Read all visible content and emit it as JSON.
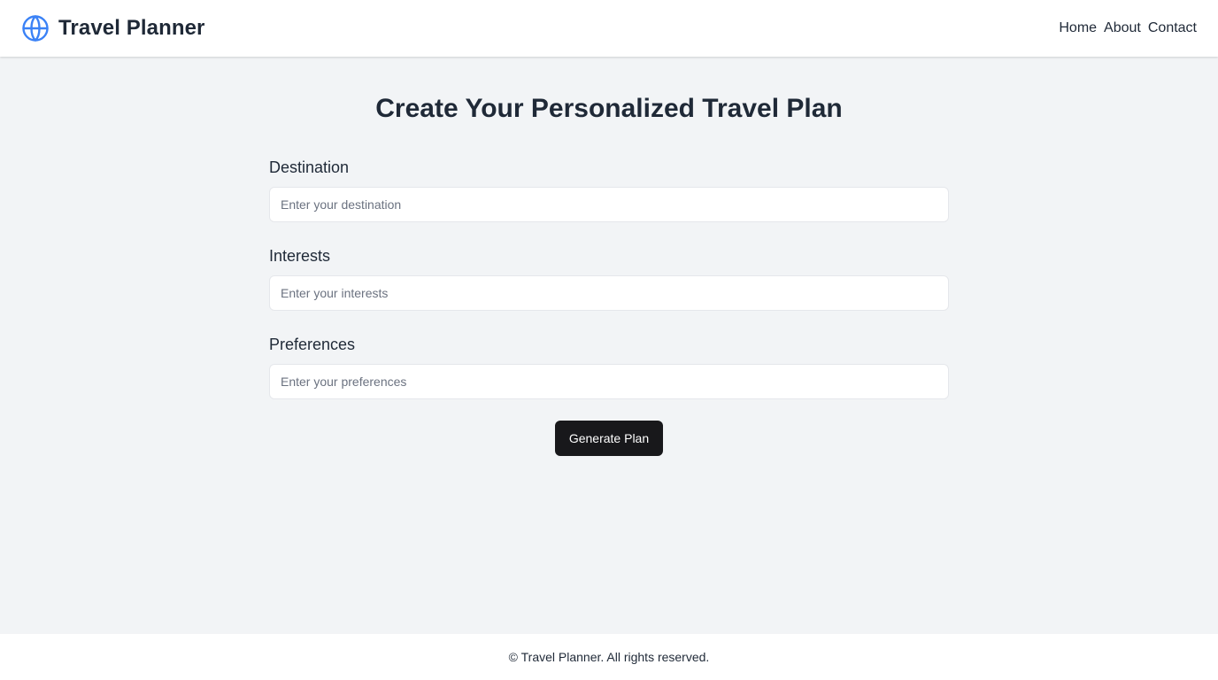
{
  "header": {
    "brand_title": "Travel Planner",
    "brand_icon": "globe-icon",
    "nav": [
      {
        "label": "Home"
      },
      {
        "label": "About"
      },
      {
        "label": "Contact"
      }
    ]
  },
  "main": {
    "title": "Create Your Personalized Travel Plan",
    "fields": {
      "destination": {
        "label": "Destination",
        "placeholder": "Enter your destination",
        "value": ""
      },
      "interests": {
        "label": "Interests",
        "placeholder": "Enter your interests",
        "value": ""
      },
      "preferences": {
        "label": "Preferences",
        "placeholder": "Enter your preferences",
        "value": ""
      }
    },
    "submit_label": "Generate Plan"
  },
  "footer": {
    "text": "© Travel Planner. All rights reserved."
  },
  "colors": {
    "accent_icon": "#3b82f6",
    "background": "#f2f4f6",
    "button": "#18181b",
    "text": "#1f2937"
  }
}
